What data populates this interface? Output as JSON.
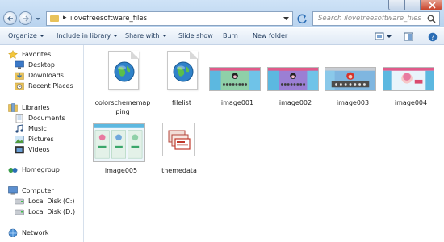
{
  "address": {
    "path": "ilovefreesoftware_files"
  },
  "search": {
    "placeholder": "Search ilovefreesoftware_files"
  },
  "toolbar": {
    "organize": "Organize",
    "include_in_library": "Include in library",
    "share_with": "Share with",
    "slide_show": "Slide show",
    "burn": "Burn",
    "new_folder": "New folder"
  },
  "sidebar": {
    "favorites": "Favorites",
    "desktop": "Desktop",
    "downloads": "Downloads",
    "recent_places": "Recent Places",
    "libraries": "Libraries",
    "documents": "Documents",
    "music": "Music",
    "pictures": "Pictures",
    "videos": "Videos",
    "homegroup": "Homegroup",
    "computer": "Computer",
    "local_disk_c": "Local Disk (C:)",
    "local_disk_d": "Local Disk (D:)",
    "network": "Network"
  },
  "files": [
    {
      "name": "colorschememapping",
      "icon": "web-document-icon"
    },
    {
      "name": "filelist",
      "icon": "web-document-icon"
    },
    {
      "name": "image001",
      "icon": "image-thumbnail"
    },
    {
      "name": "image002",
      "icon": "image-thumbnail"
    },
    {
      "name": "image003",
      "icon": "image-thumbnail"
    },
    {
      "name": "image004",
      "icon": "image-thumbnail"
    },
    {
      "name": "image005",
      "icon": "image-thumbnail"
    },
    {
      "name": "themedata",
      "icon": "theme-file-icon"
    }
  ],
  "colors": {
    "accent": "#1e395b",
    "titlebar": "#cfe3f7",
    "close": "#c9452d"
  }
}
